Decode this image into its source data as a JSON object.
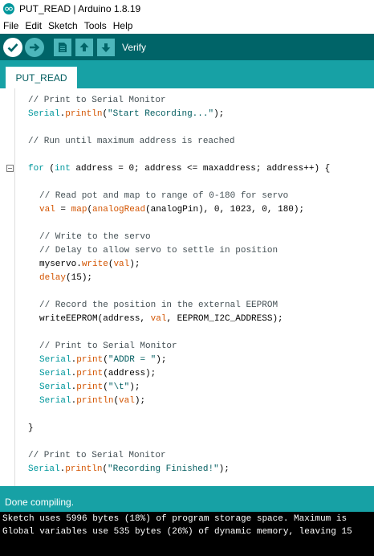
{
  "window": {
    "title": "PUT_READ | Arduino 1.8.19"
  },
  "menu": [
    "File",
    "Edit",
    "Sketch",
    "Tools",
    "Help"
  ],
  "toolbar": {
    "verify_label": "Verify"
  },
  "tabs": [
    {
      "label": "PUT_READ"
    }
  ],
  "editor": {
    "lines": [
      [
        {
          "c": "cmt",
          "t": "// Print to Serial Monitor"
        }
      ],
      [
        {
          "c": "kw",
          "t": "Serial"
        },
        {
          "c": "",
          "t": "."
        },
        {
          "c": "fn",
          "t": "println"
        },
        {
          "c": "",
          "t": "("
        },
        {
          "c": "str",
          "t": "\"Start Recording...\""
        },
        {
          "c": "",
          "t": ");"
        }
      ],
      [
        {
          "c": "cmt",
          "t": "// Run until maximum address is reached"
        }
      ],
      [
        {
          "c": "kw",
          "t": "for"
        },
        {
          "c": "",
          "t": " ("
        },
        {
          "c": "kw",
          "t": "int"
        },
        {
          "c": "",
          "t": " address = 0; address <= maxaddress; address++) {"
        }
      ],
      [
        {
          "c": "cmt",
          "t": "// Read pot and map to range of 0-180 for servo"
        }
      ],
      [
        {
          "c": "fn",
          "t": "val"
        },
        {
          "c": "",
          "t": " = "
        },
        {
          "c": "fn",
          "t": "map"
        },
        {
          "c": "",
          "t": "("
        },
        {
          "c": "fn",
          "t": "analogRead"
        },
        {
          "c": "",
          "t": "(analogPin), 0, 1023, 0, 180);"
        }
      ],
      [
        {
          "c": "cmt",
          "t": "// Write to the servo"
        }
      ],
      [
        {
          "c": "cmt",
          "t": "// Delay to allow servo to settle in position"
        }
      ],
      [
        {
          "c": "",
          "t": "myservo."
        },
        {
          "c": "fn",
          "t": "write"
        },
        {
          "c": "",
          "t": "("
        },
        {
          "c": "fn",
          "t": "val"
        },
        {
          "c": "",
          "t": ");"
        }
      ],
      [
        {
          "c": "fn",
          "t": "delay"
        },
        {
          "c": "",
          "t": "(15);"
        }
      ],
      [
        {
          "c": "cmt",
          "t": "// Record the position in the external EEPROM"
        }
      ],
      [
        {
          "c": "",
          "t": "writeEEPROM(address, "
        },
        {
          "c": "fn",
          "t": "val"
        },
        {
          "c": "",
          "t": ", EEPROM_I2C_ADDRESS);"
        }
      ],
      [
        {
          "c": "cmt",
          "t": "// Print to Serial Monitor"
        }
      ],
      [
        {
          "c": "kw",
          "t": "Serial"
        },
        {
          "c": "",
          "t": "."
        },
        {
          "c": "fn",
          "t": "print"
        },
        {
          "c": "",
          "t": "("
        },
        {
          "c": "str",
          "t": "\"ADDR = \""
        },
        {
          "c": "",
          "t": ");"
        }
      ],
      [
        {
          "c": "kw",
          "t": "Serial"
        },
        {
          "c": "",
          "t": "."
        },
        {
          "c": "fn",
          "t": "print"
        },
        {
          "c": "",
          "t": "(address);"
        }
      ],
      [
        {
          "c": "kw",
          "t": "Serial"
        },
        {
          "c": "",
          "t": "."
        },
        {
          "c": "fn",
          "t": "print"
        },
        {
          "c": "",
          "t": "("
        },
        {
          "c": "str",
          "t": "\"\\t\""
        },
        {
          "c": "",
          "t": ");"
        }
      ],
      [
        {
          "c": "kw",
          "t": "Serial"
        },
        {
          "c": "",
          "t": "."
        },
        {
          "c": "fn",
          "t": "println"
        },
        {
          "c": "",
          "t": "("
        },
        {
          "c": "fn",
          "t": "val"
        },
        {
          "c": "",
          "t": ");"
        }
      ],
      [
        {
          "c": "",
          "t": "}"
        }
      ],
      [
        {
          "c": "cmt",
          "t": "// Print to Serial Monitor"
        }
      ],
      [
        {
          "c": "kw",
          "t": "Serial"
        },
        {
          "c": "",
          "t": "."
        },
        {
          "c": "fn",
          "t": "println"
        },
        {
          "c": "",
          "t": "("
        },
        {
          "c": "str",
          "t": "\"Recording Finished!\""
        },
        {
          "c": "",
          "t": ");"
        }
      ]
    ]
  },
  "status": {
    "text": "Done compiling."
  },
  "console": {
    "lines": [
      "Sketch uses 5996 bytes (18%) of program storage space. Maximum is",
      "Global variables use 535 bytes (26%) of dynamic memory, leaving 15"
    ]
  },
  "colors": {
    "toolbar": "#006468",
    "tabstrip": "#17a1a5",
    "keyword": "#00979c",
    "function": "#d35400",
    "comment": "#434f54"
  }
}
